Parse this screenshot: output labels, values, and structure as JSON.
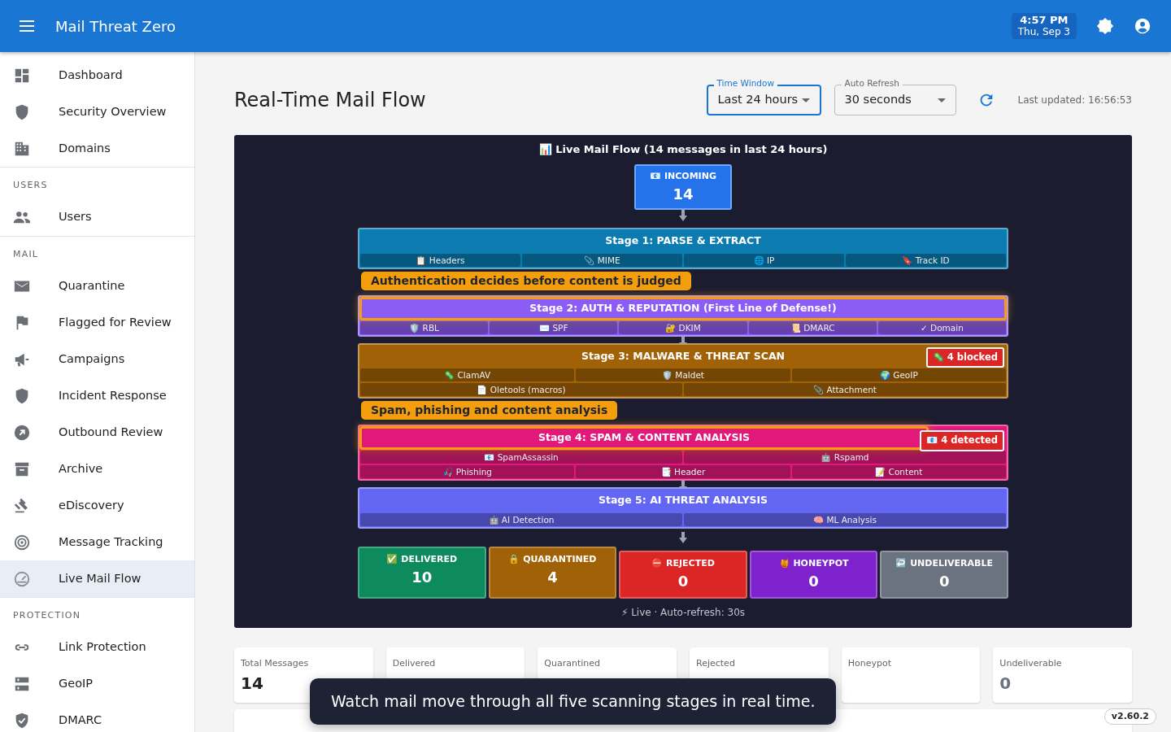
{
  "app_bar": {
    "title": "Mail Threat Zero",
    "clock": {
      "time": "4:57 PM",
      "date": "Thu, Sep 3"
    }
  },
  "sidebar": {
    "sections": [
      {
        "items": [
          {
            "label": "Dashboard",
            "selected": false
          },
          {
            "label": "Security Overview",
            "selected": false
          },
          {
            "label": "Domains",
            "selected": false
          }
        ]
      },
      {
        "heading": "USERS",
        "items": [
          {
            "label": "Users",
            "selected": false
          }
        ]
      },
      {
        "heading": "MAIL",
        "items": [
          {
            "label": "Quarantine",
            "selected": false
          },
          {
            "label": "Flagged for Review",
            "selected": false
          },
          {
            "label": "Campaigns",
            "selected": false
          },
          {
            "label": "Incident Response",
            "selected": false
          },
          {
            "label": "Outbound Review",
            "selected": false
          },
          {
            "label": "Archive",
            "selected": false
          },
          {
            "label": "eDiscovery",
            "selected": false
          },
          {
            "label": "Message Tracking",
            "selected": false
          },
          {
            "label": "Live Mail Flow",
            "selected": true
          }
        ]
      },
      {
        "heading": "PROTECTION",
        "items": [
          {
            "label": "Link Protection",
            "selected": false
          },
          {
            "label": "GeoIP",
            "selected": false
          },
          {
            "label": "DMARC",
            "selected": false
          }
        ]
      }
    ]
  },
  "page": {
    "title": "Real-Time Mail Flow",
    "controls": [
      {
        "label": "Time Window",
        "value": "Last 24 hours",
        "focused": true
      },
      {
        "label": "Auto Refresh",
        "value": "30 seconds",
        "focused": false
      }
    ],
    "last_updated": "Last updated: 16:56:53"
  },
  "flow": {
    "title": "📊 Live Mail Flow (14 messages in last 24 hours)",
    "incoming": {
      "label": "📧 INCOMING",
      "count": "14"
    },
    "stages": [
      {
        "title": "Stage 1: PARSE & EXTRACT",
        "color": "#0b7bb0",
        "highlighted": false,
        "rows": [
          [
            "📋 Headers",
            "📎 MIME",
            "🌐 IP",
            "🔖 Track ID"
          ]
        ]
      },
      {
        "callout": "Authentication decides before content is judged",
        "title": "Stage 2: AUTH & REPUTATION (First Line of Defense!)",
        "color": "#8b5cf6",
        "highlighted": true,
        "rows": [
          [
            "🛡️ RBL",
            "✉️ SPF",
            "🔐 DKIM",
            "📜 DMARC",
            "✓ Domain"
          ]
        ]
      },
      {
        "title": "Stage 3: MALWARE & THREAT SCAN",
        "color": "#a16207",
        "highlighted": false,
        "badge": "🦠 4 blocked",
        "rows": [
          [
            "🦠 ClamAV",
            "🛡️ Maldet",
            "🌍 GeoIP"
          ],
          [
            "📄 Oletools (macros)",
            "📎 Attachment"
          ]
        ]
      },
      {
        "callout": "Spam, phishing and content analysis",
        "title": "Stage 4: SPAM & CONTENT ANALYSIS",
        "color": "#e0197a",
        "highlighted": true,
        "badge": "📧 4 detected",
        "rows": [
          [
            "📧 SpamAssassin",
            "🤖 Rspamd"
          ],
          [
            "🎣 Phishing",
            "📑 Header",
            "📝 Content"
          ]
        ]
      },
      {
        "title": "Stage 5: AI THREAT ANALYSIS",
        "color": "#6366f1",
        "highlighted": false,
        "rows": [
          [
            "🤖 AI Detection",
            "🧠 ML Analysis"
          ]
        ]
      }
    ],
    "outcomes": [
      {
        "label": "✅ DELIVERED",
        "count": "10",
        "color": "#0e8a5f"
      },
      {
        "label": "🔒 QUARANTINED",
        "count": "4",
        "color": "#a16207"
      },
      {
        "label": "⛔ REJECTED",
        "count": "0",
        "color": "#dc2626"
      },
      {
        "label": "🍯 HONEYPOT",
        "count": "0",
        "color": "#7e22ce"
      },
      {
        "label": "↩️ UNDELIVERABLE",
        "count": "0",
        "color": "#6b7280"
      }
    ],
    "footer": "⚡ Live · Auto-refresh: 30s"
  },
  "stats": [
    {
      "label": "Total Messages",
      "value": "14"
    },
    {
      "label": "Delivered"
    },
    {
      "label": "Quarantined"
    },
    {
      "label": "Rejected"
    },
    {
      "label": "Honeypot"
    },
    {
      "label": "Undeliverable",
      "value": "0"
    }
  ],
  "tooltip": "Watch mail move through all five scanning stages in real time.",
  "version": "v2.60.2"
}
